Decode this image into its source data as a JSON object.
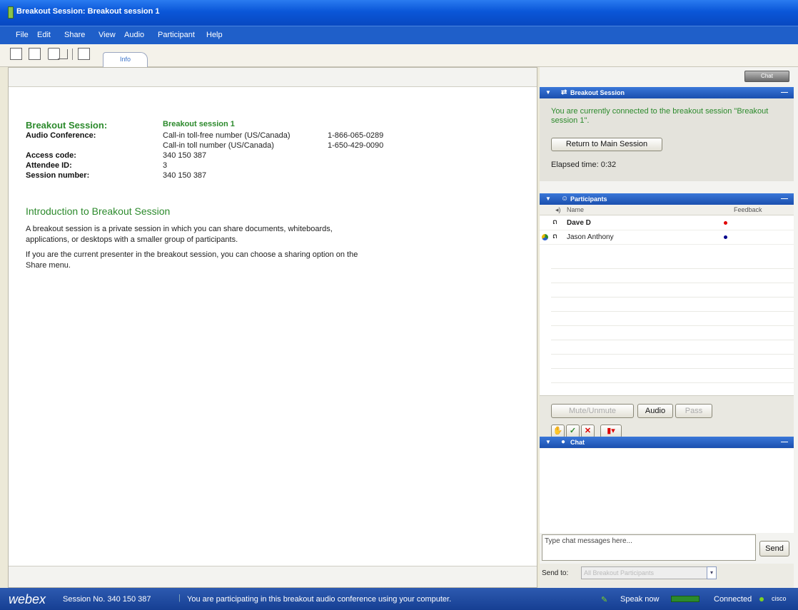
{
  "window": {
    "title": "Breakout Session: Breakout session 1"
  },
  "menu": [
    "File",
    "Edit",
    "Share",
    "View",
    "Audio",
    "Participant",
    "Help"
  ],
  "toolbar": {
    "tab_label": "Info"
  },
  "info": {
    "breakout_label": "Breakout Session:",
    "breakout_value": "Breakout session 1",
    "audio_label": "Audio Conference:",
    "tollfree_desc": "Call-in toll-free number (US/Canada)",
    "tollfree_number": "1-866-065-0289",
    "toll_desc": "Call-in toll number (US/Canada)",
    "toll_number": "1-650-429-0090",
    "access_label": "Access code:",
    "access_value": "340 150 387",
    "attendee_label": "Attendee ID:",
    "attendee_value": "3",
    "session_label": "Session number:",
    "session_value": "340 150 387",
    "intro_heading": "Introduction to Breakout Session",
    "intro_p1": "A breakout session is a private session in which you can share documents, whiteboards, applications, or desktops with a smaller group of participants.",
    "intro_p2": "If you are the current presenter in the breakout session, you can choose a sharing option on the Share menu."
  },
  "right_top": {
    "button_label": "Chat"
  },
  "breakout_panel": {
    "title": "Breakout Session",
    "status_text": "You are currently connected to the breakout session \"Breakout session 1\".",
    "return_button": "Return to Main Session",
    "elapsed": "Elapsed time: 0:32"
  },
  "participants_panel": {
    "title": "Participants",
    "col_name": "Name",
    "col_feedback": "Feedback",
    "rows": [
      {
        "name": "Dave D",
        "dot_color": "#e00000"
      },
      {
        "name": "Jason Anthony",
        "dot_color": "#00008b"
      }
    ]
  },
  "controls": {
    "mute_button": "Mute/Unmute",
    "audio_button": "Audio",
    "raise_button": "Pass"
  },
  "chat_panel": {
    "title": "Chat",
    "input_placeholder": "Type chat messages here...",
    "send_button": "Send",
    "send_to_label": "Send to:",
    "send_to_value": "All Breakout Participants"
  },
  "statusbar": {
    "logo": "webex",
    "session_no": "Session No. 340 150 387",
    "audio_msg": "You are participating in this breakout audio conference using your computer.",
    "speak_now": "Speak now",
    "connected": "Connected",
    "cisco": "cisco"
  }
}
